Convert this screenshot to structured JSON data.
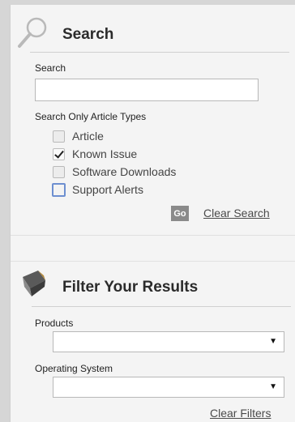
{
  "search": {
    "title": "Search",
    "field_label": "Search",
    "field_value": "",
    "field_placeholder": "",
    "types_label": "Search Only Article Types",
    "article_types": [
      {
        "label": "Article",
        "checked": false
      },
      {
        "label": "Known Issue",
        "checked": true
      },
      {
        "label": "Software Downloads",
        "checked": false
      },
      {
        "label": "Support Alerts",
        "checked": false,
        "focused": true
      }
    ],
    "go_label": "Go",
    "clear_label": "Clear Search"
  },
  "filter": {
    "title": "Filter Your Results",
    "products_label": "Products",
    "products_value": "",
    "os_label": "Operating System",
    "os_value": "",
    "clear_label": "Clear Filters"
  },
  "icons": {
    "search": "magnifier-icon",
    "filter": "funnel-icon",
    "dropdown": "chevron-down-icon"
  },
  "colors": {
    "background": "#f4f4f4",
    "go_button": "#8a8a8a",
    "focus_ring": "#6d8fd0"
  }
}
